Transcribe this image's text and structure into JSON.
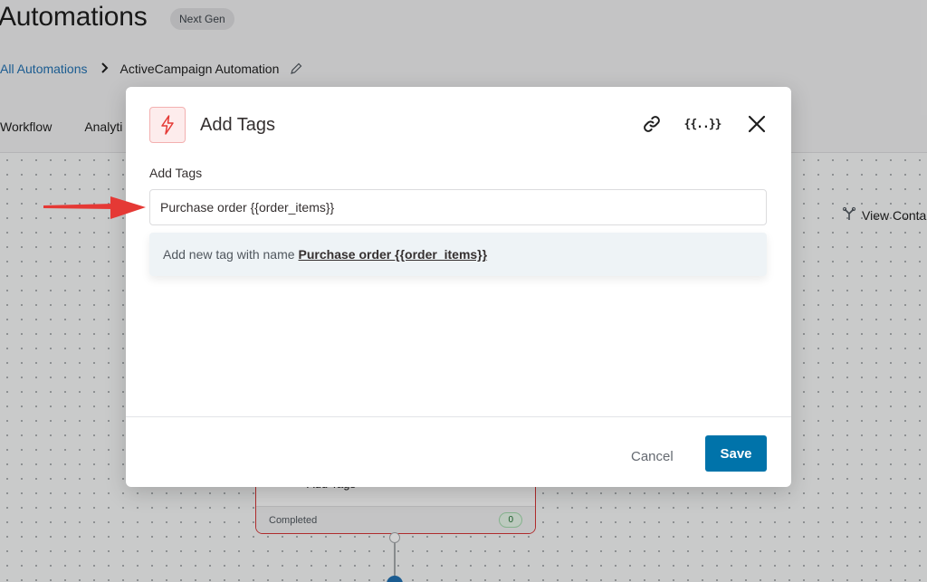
{
  "page": {
    "title": "Automations",
    "badge": "Next Gen",
    "breadcrumb": {
      "root": "All Automations",
      "current": "ActiveCampaign Automation"
    },
    "tabs": [
      {
        "label": "Workflow",
        "active": true
      },
      {
        "label": "Analyti",
        "active": false
      }
    ],
    "view_contacts": "View Conta",
    "node": {
      "label": "Add Tags",
      "status": "Completed",
      "count": "0"
    }
  },
  "modal": {
    "title": "Add Tags",
    "icon": "bolt-icon",
    "header_actions": {
      "link_icon": "link-icon",
      "merge_tags_label": "{{..}}",
      "close_icon": "close-icon"
    },
    "field_label": "Add Tags",
    "input_value": "Purchase order {{order_items}}",
    "suggestion": {
      "prefix": "Add new tag with name",
      "tag": "Purchase order {{order_items}}"
    },
    "cancel_label": "Cancel",
    "save_label": "Save"
  },
  "colors": {
    "primary": "#0073aa",
    "accent_red": "#e53935",
    "link_blue": "#2271b1"
  }
}
